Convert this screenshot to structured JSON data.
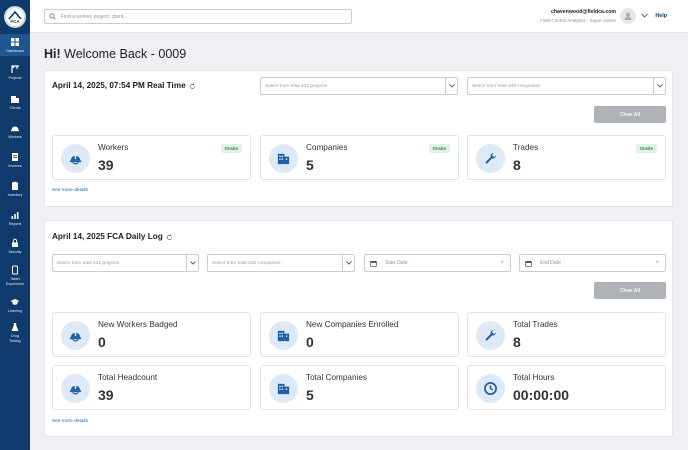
{
  "brand": {
    "logo_text": "FCA",
    "accent": "#0f3a6b",
    "icon_bg": "#dde9f7",
    "icon_color": "#1f5fa6",
    "onsite_bg": "#dff3e6",
    "onsite_color": "#2e7d4f"
  },
  "sidebar": {
    "items": [
      {
        "label": "Dashboard",
        "icon": "dashboard-icon"
      },
      {
        "label": "Projects",
        "icon": "crane-icon"
      },
      {
        "label": "Clients",
        "icon": "building-icon"
      },
      {
        "label": "Workers",
        "icon": "hardhat-icon"
      },
      {
        "label": "Invoices",
        "icon": "invoice-icon"
      },
      {
        "label": "Inventory",
        "icon": "clipboard-icon"
      },
      {
        "label": "Reports",
        "icon": "bar-chart-icon"
      },
      {
        "label": "Security",
        "icon": "lock-icon"
      },
      {
        "label": "Tablet",
        "label2": "Experience",
        "icon": "tablet-icon"
      },
      {
        "label": "Learning",
        "icon": "graduation-cap-icon"
      },
      {
        "label": "Drug",
        "label2": "Testing",
        "icon": "flask-icon"
      }
    ]
  },
  "topbar": {
    "search_placeholder": "Find a worker, project, client...",
    "user_email": "chavenwood@fieldca.com",
    "user_role": "Field Control Analytics - Super Admin",
    "help_label": "Help"
  },
  "welcome": {
    "greeting": "Hi!",
    "message": "Welcome Back - 0009"
  },
  "realtime": {
    "title": "April 14, 2025, 07:54 PM Real Time",
    "project_select_placeholder": "Select from total 231 projects",
    "company_select_placeholder": "Select from total 345 companies",
    "clear_label": "Clear All",
    "stats": [
      {
        "label": "Workers",
        "value": "39",
        "badge": "Onsite",
        "icon": "hardhat-icon"
      },
      {
        "label": "Companies",
        "value": "5",
        "badge": "Onsite",
        "icon": "building-icon"
      },
      {
        "label": "Trades",
        "value": "8",
        "badge": "Onsite",
        "icon": "wrench-icon"
      }
    ],
    "see_more": "See more details"
  },
  "daily": {
    "title": "April 14, 2025 FCA Daily Log",
    "project_select_placeholder": "Select from total 231 projects",
    "company_select_placeholder": "Select from total 345 companies",
    "start_date_placeholder": "Start Date",
    "end_date_placeholder": "End Date",
    "clear_label": "Clear All",
    "stats": [
      {
        "label": "New Workers Badged",
        "value": "0",
        "icon": "hardhat-icon"
      },
      {
        "label": "New Companies Enrolled",
        "value": "0",
        "icon": "building-icon"
      },
      {
        "label": "Total Trades",
        "value": "8",
        "icon": "wrench-icon"
      },
      {
        "label": "Total Headcount",
        "value": "39",
        "icon": "hardhat-icon"
      },
      {
        "label": "Total Companies",
        "value": "5",
        "icon": "building-icon"
      },
      {
        "label": "Total Hours",
        "value": "00:00:00",
        "icon": "clock-icon"
      }
    ],
    "see_more": "See more details"
  }
}
